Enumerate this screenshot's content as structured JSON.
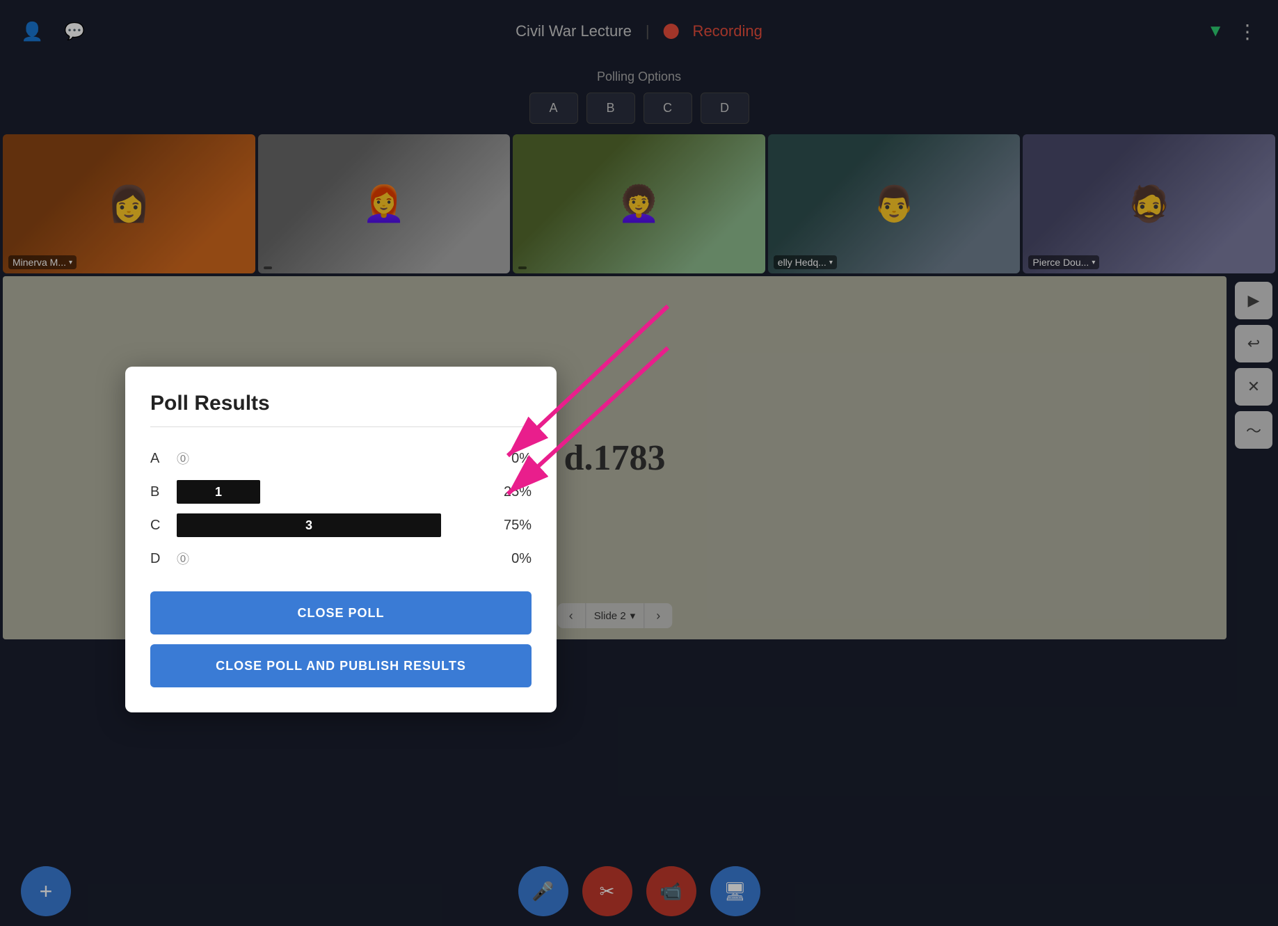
{
  "header": {
    "title": "Civil War Lecture",
    "recording_label": "Recording",
    "divider": "|"
  },
  "polling": {
    "title": "Polling Options",
    "options": [
      "A",
      "B",
      "C",
      "D"
    ]
  },
  "participants": [
    {
      "name": "Minerva M...",
      "has_chevron": true
    },
    {
      "name": "",
      "has_chevron": false
    },
    {
      "name": "",
      "has_chevron": false
    },
    {
      "name": "elly Hedq...",
      "has_chevron": true
    },
    {
      "name": "Pierce Dou...",
      "has_chevron": true
    }
  ],
  "slide": {
    "text": "d.1783",
    "nav_label": "Slide 2"
  },
  "poll_results": {
    "title": "Poll Results",
    "rows": [
      {
        "letter": "A",
        "count": 0,
        "bar_width_pct": 0,
        "pct": "0%",
        "has_bar": false
      },
      {
        "letter": "B",
        "count": 1,
        "bar_width_pct": 25,
        "pct": "25%",
        "has_bar": true
      },
      {
        "letter": "C",
        "count": 3,
        "bar_width_pct": 75,
        "pct": "75%",
        "has_bar": true
      },
      {
        "letter": "D",
        "count": 0,
        "bar_width_pct": 0,
        "pct": "0%",
        "has_bar": false
      }
    ],
    "close_poll_label": "CLOSE POLL",
    "close_publish_label": "CLOSE POLL AND PUBLISH RESULTS"
  },
  "bottom_bar": {
    "add_label": "+",
    "mic_label": "🎤",
    "scissors_label": "✂",
    "video_label": "📹",
    "screen_label": "🖥"
  },
  "toolbar": {
    "cursor_label": "▶",
    "undo_label": "↩",
    "close_label": "✕",
    "chart_label": "📈"
  }
}
